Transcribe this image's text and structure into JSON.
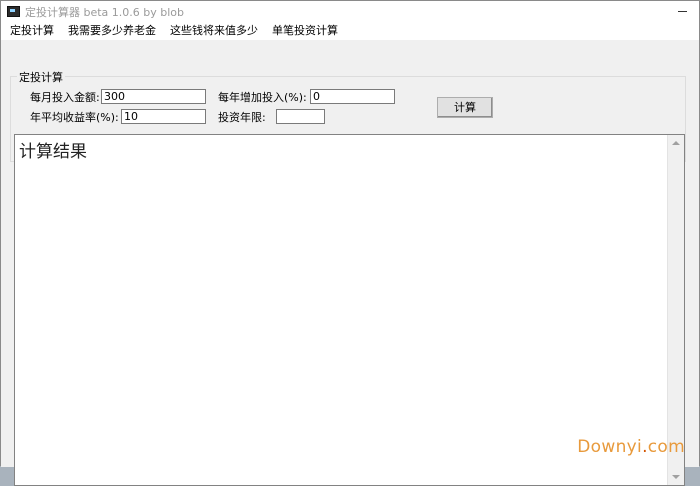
{
  "window": {
    "title": "定投计算器 beta 1.0.6 by blob",
    "icon": "calculator-app-icon"
  },
  "menu": {
    "items": [
      "定投计算",
      "我需要多少养老金",
      "这些钱将来值多少",
      "单笔投资计算"
    ]
  },
  "form": {
    "group_title": "定投计算",
    "monthly_label": "每月投入金额:",
    "monthly_value": "300",
    "annual_increase_label": "每年增加投入(%):",
    "annual_increase_value": "0",
    "return_rate_label": "年平均收益率(%):",
    "return_rate_value": "10",
    "years_label": "投资年限:",
    "years_value": "",
    "calculate_button": "计算"
  },
  "result": {
    "text": "计算结果"
  },
  "watermark": {
    "brand": "Downyi",
    "sep": ".",
    "tld": "com"
  }
}
